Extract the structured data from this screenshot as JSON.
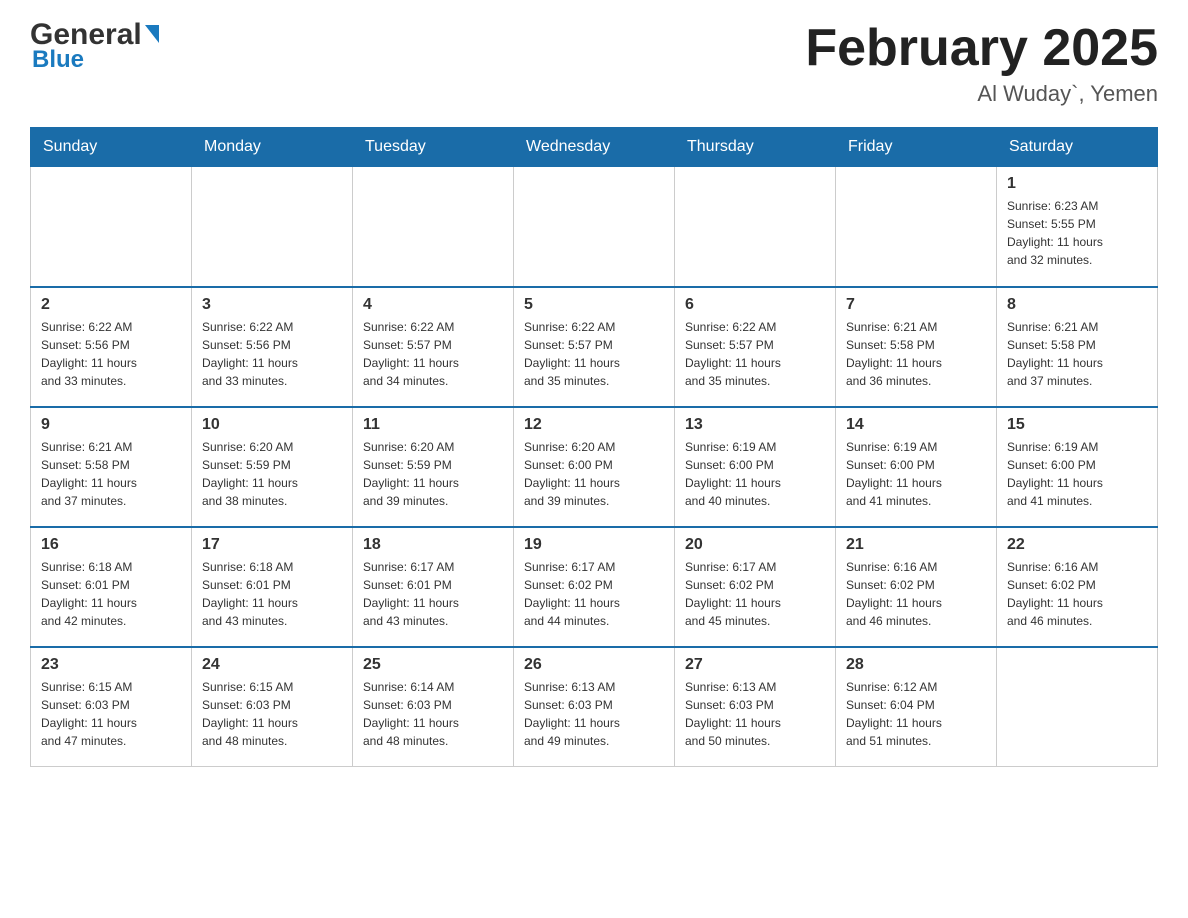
{
  "header": {
    "logo_general": "General",
    "logo_blue": "Blue",
    "month_title": "February 2025",
    "location": "Al Wuday`, Yemen"
  },
  "weekdays": [
    "Sunday",
    "Monday",
    "Tuesday",
    "Wednesday",
    "Thursday",
    "Friday",
    "Saturday"
  ],
  "weeks": [
    [
      {
        "day": "",
        "info": ""
      },
      {
        "day": "",
        "info": ""
      },
      {
        "day": "",
        "info": ""
      },
      {
        "day": "",
        "info": ""
      },
      {
        "day": "",
        "info": ""
      },
      {
        "day": "",
        "info": ""
      },
      {
        "day": "1",
        "info": "Sunrise: 6:23 AM\nSunset: 5:55 PM\nDaylight: 11 hours\nand 32 minutes."
      }
    ],
    [
      {
        "day": "2",
        "info": "Sunrise: 6:22 AM\nSunset: 5:56 PM\nDaylight: 11 hours\nand 33 minutes."
      },
      {
        "day": "3",
        "info": "Sunrise: 6:22 AM\nSunset: 5:56 PM\nDaylight: 11 hours\nand 33 minutes."
      },
      {
        "day": "4",
        "info": "Sunrise: 6:22 AM\nSunset: 5:57 PM\nDaylight: 11 hours\nand 34 minutes."
      },
      {
        "day": "5",
        "info": "Sunrise: 6:22 AM\nSunset: 5:57 PM\nDaylight: 11 hours\nand 35 minutes."
      },
      {
        "day": "6",
        "info": "Sunrise: 6:22 AM\nSunset: 5:57 PM\nDaylight: 11 hours\nand 35 minutes."
      },
      {
        "day": "7",
        "info": "Sunrise: 6:21 AM\nSunset: 5:58 PM\nDaylight: 11 hours\nand 36 minutes."
      },
      {
        "day": "8",
        "info": "Sunrise: 6:21 AM\nSunset: 5:58 PM\nDaylight: 11 hours\nand 37 minutes."
      }
    ],
    [
      {
        "day": "9",
        "info": "Sunrise: 6:21 AM\nSunset: 5:58 PM\nDaylight: 11 hours\nand 37 minutes."
      },
      {
        "day": "10",
        "info": "Sunrise: 6:20 AM\nSunset: 5:59 PM\nDaylight: 11 hours\nand 38 minutes."
      },
      {
        "day": "11",
        "info": "Sunrise: 6:20 AM\nSunset: 5:59 PM\nDaylight: 11 hours\nand 39 minutes."
      },
      {
        "day": "12",
        "info": "Sunrise: 6:20 AM\nSunset: 6:00 PM\nDaylight: 11 hours\nand 39 minutes."
      },
      {
        "day": "13",
        "info": "Sunrise: 6:19 AM\nSunset: 6:00 PM\nDaylight: 11 hours\nand 40 minutes."
      },
      {
        "day": "14",
        "info": "Sunrise: 6:19 AM\nSunset: 6:00 PM\nDaylight: 11 hours\nand 41 minutes."
      },
      {
        "day": "15",
        "info": "Sunrise: 6:19 AM\nSunset: 6:00 PM\nDaylight: 11 hours\nand 41 minutes."
      }
    ],
    [
      {
        "day": "16",
        "info": "Sunrise: 6:18 AM\nSunset: 6:01 PM\nDaylight: 11 hours\nand 42 minutes."
      },
      {
        "day": "17",
        "info": "Sunrise: 6:18 AM\nSunset: 6:01 PM\nDaylight: 11 hours\nand 43 minutes."
      },
      {
        "day": "18",
        "info": "Sunrise: 6:17 AM\nSunset: 6:01 PM\nDaylight: 11 hours\nand 43 minutes."
      },
      {
        "day": "19",
        "info": "Sunrise: 6:17 AM\nSunset: 6:02 PM\nDaylight: 11 hours\nand 44 minutes."
      },
      {
        "day": "20",
        "info": "Sunrise: 6:17 AM\nSunset: 6:02 PM\nDaylight: 11 hours\nand 45 minutes."
      },
      {
        "day": "21",
        "info": "Sunrise: 6:16 AM\nSunset: 6:02 PM\nDaylight: 11 hours\nand 46 minutes."
      },
      {
        "day": "22",
        "info": "Sunrise: 6:16 AM\nSunset: 6:02 PM\nDaylight: 11 hours\nand 46 minutes."
      }
    ],
    [
      {
        "day": "23",
        "info": "Sunrise: 6:15 AM\nSunset: 6:03 PM\nDaylight: 11 hours\nand 47 minutes."
      },
      {
        "day": "24",
        "info": "Sunrise: 6:15 AM\nSunset: 6:03 PM\nDaylight: 11 hours\nand 48 minutes."
      },
      {
        "day": "25",
        "info": "Sunrise: 6:14 AM\nSunset: 6:03 PM\nDaylight: 11 hours\nand 48 minutes."
      },
      {
        "day": "26",
        "info": "Sunrise: 6:13 AM\nSunset: 6:03 PM\nDaylight: 11 hours\nand 49 minutes."
      },
      {
        "day": "27",
        "info": "Sunrise: 6:13 AM\nSunset: 6:03 PM\nDaylight: 11 hours\nand 50 minutes."
      },
      {
        "day": "28",
        "info": "Sunrise: 6:12 AM\nSunset: 6:04 PM\nDaylight: 11 hours\nand 51 minutes."
      },
      {
        "day": "",
        "info": ""
      }
    ]
  ]
}
